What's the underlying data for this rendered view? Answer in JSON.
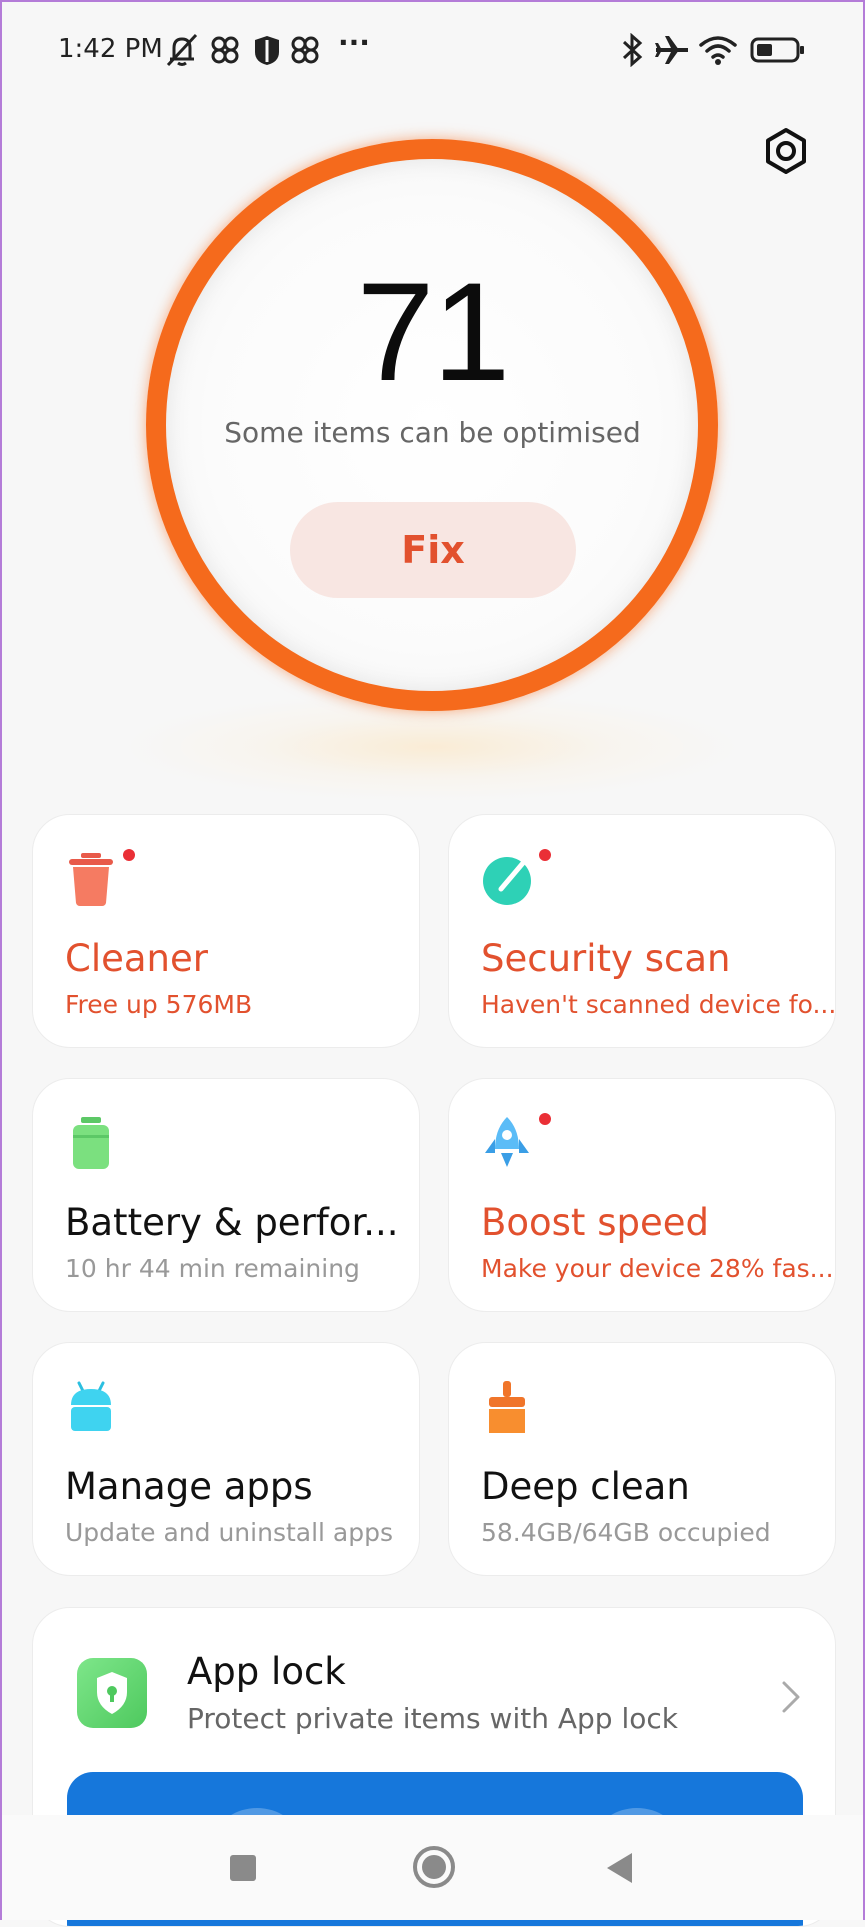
{
  "status_bar": {
    "time": "1:42 PM",
    "more": "···",
    "left_icons": [
      "muted-icon",
      "fan-icon",
      "shield-app-icon",
      "fan-icon"
    ],
    "right_icons": [
      "bluetooth-icon",
      "airplane-icon",
      "wifi-icon",
      "battery-icon"
    ]
  },
  "header": {
    "settings_icon": "settings-icon"
  },
  "score": {
    "value": "71",
    "message": "Some items can be optimised",
    "fix_label": "Fix",
    "ring_color": "#f56a1c",
    "fix_text_color": "#e2512e"
  },
  "cards": [
    {
      "id": "cleaner",
      "title": "Cleaner",
      "subtitle": "Free up 576MB",
      "icon": "trash-icon",
      "alert": true,
      "color": "#f57b62"
    },
    {
      "id": "security-scan",
      "title": "Security scan",
      "subtitle": "Haven't scanned device fo...",
      "icon": "scan-icon",
      "alert": true,
      "color": "#2ed1b6"
    },
    {
      "id": "battery",
      "title": "Battery & perfor...",
      "subtitle": "10 hr 44 min  remaining",
      "icon": "battery-icon",
      "alert": false,
      "color": "#7be07f"
    },
    {
      "id": "boost-speed",
      "title": "Boost speed",
      "subtitle": "Make your device 28% fas...",
      "icon": "rocket-icon",
      "alert": true,
      "color": "#5bbcf7"
    },
    {
      "id": "manage-apps",
      "title": "Manage apps",
      "subtitle": "Update and uninstall apps",
      "icon": "android-icon",
      "alert": false,
      "color": "#3fd3f0"
    },
    {
      "id": "deep-clean",
      "title": "Deep clean",
      "subtitle": "58.4GB/64GB occupied",
      "icon": "brush-icon",
      "alert": false,
      "color": "#f88e2f"
    }
  ],
  "app_lock": {
    "title": "App lock",
    "subtitle": "Protect private items with App lock",
    "icon": "lock-shield-icon",
    "banner_color": "#1677db"
  },
  "nav_bar": {
    "buttons": [
      "recents-button",
      "home-button",
      "back-button"
    ]
  },
  "colors": {
    "alert_text": "#e2512e",
    "badge": "#ea2f36",
    "background": "#f7f7f7"
  }
}
